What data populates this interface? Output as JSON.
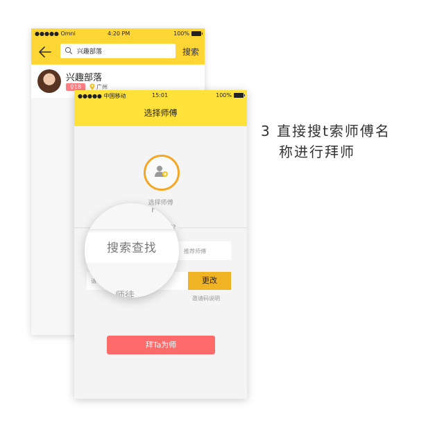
{
  "back_screen": {
    "status": {
      "carrier": "●●●●● Omni",
      "time": "4:20 PM",
      "battery": "100%"
    },
    "search": {
      "query": "兴趣部落",
      "button": "搜索"
    },
    "result": {
      "name": "兴趣部落",
      "age_badge": "♀18",
      "location": "广州"
    }
  },
  "front_screen": {
    "status": {
      "carrier": "●●●●● 中国移动",
      "time": "15:01",
      "battery": "100%"
    },
    "title": "选择师傅",
    "avatar_label": "选择师傅",
    "divider_text": "谁?",
    "search_placeholder": "搜索查找",
    "recommend_label": "推荐师傅",
    "invite_placeholder": "请",
    "change_button": "更改",
    "invite_help": "邀请码说明",
    "follow_button": "拜Ta为师",
    "partial_text": "师徒",
    "partial_top": "F"
  },
  "caption": {
    "line1": "3 直接搜t索师傅名",
    "line2": "称进行拜师"
  },
  "colors": {
    "header_yellow": "#ffd633",
    "accent_orange": "#f0b323",
    "button_red": "#ff6b6b",
    "badge_pink": "#ff7f84"
  }
}
